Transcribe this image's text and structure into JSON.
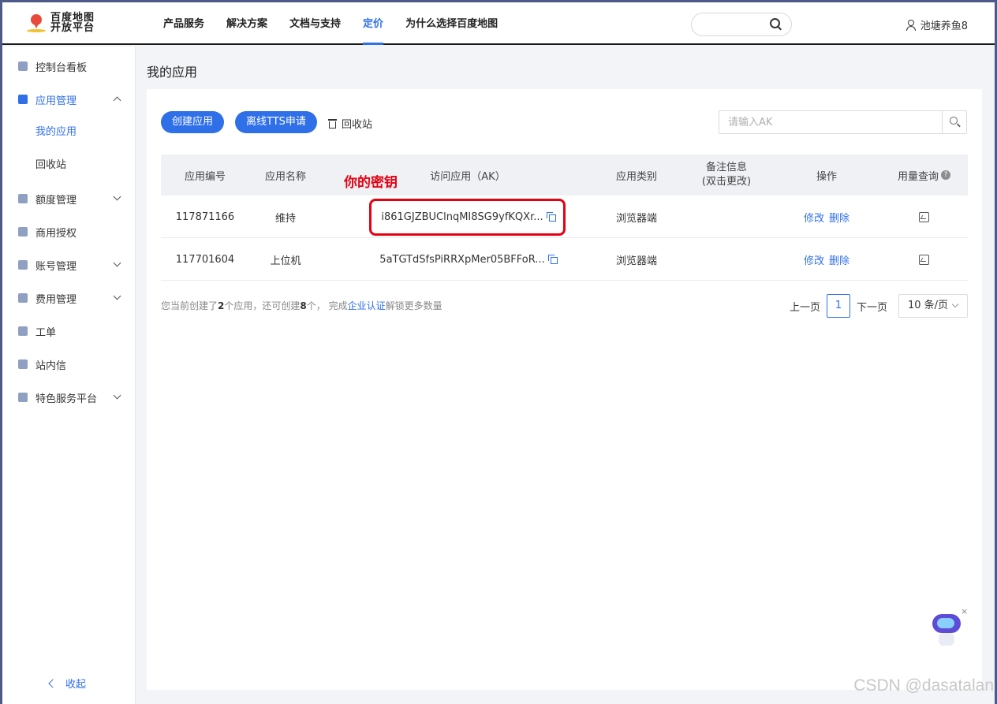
{
  "header": {
    "logo_line1": "百度地图",
    "logo_line2": "开放平台",
    "nav": [
      "产品服务",
      "解决方案",
      "文档与支持",
      "定价",
      "为什么选择百度地图"
    ],
    "active_nav": "定价",
    "user_name": "池塘养鱼8"
  },
  "sidebar": {
    "items": [
      {
        "label": "控制台看板"
      },
      {
        "label": "应用管理"
      },
      {
        "label": "额度管理"
      },
      {
        "label": "商用授权"
      },
      {
        "label": "账号管理"
      },
      {
        "label": "费用管理"
      },
      {
        "label": "工单"
      },
      {
        "label": "站内信"
      },
      {
        "label": "特色服务平台"
      }
    ],
    "sub_items": [
      "我的应用",
      "回收站"
    ],
    "collapse_label": "收起"
  },
  "main": {
    "page_title": "我的应用",
    "create_button": "创建应用",
    "tts_button": "离线TTS申请",
    "recycle_label": "回收站",
    "search_placeholder": "请输入AK",
    "columns": {
      "id": "应用编号",
      "name": "应用名称",
      "ak": "访问应用（AK）",
      "type": "应用类别",
      "note_line1": "备注信息",
      "note_line2": "(双击更改)",
      "actions": "操作",
      "usage": "用量查询"
    },
    "rows": [
      {
        "id": "117871166",
        "name": "维持",
        "ak": "i861GJZBUClnqMI8SG9yfKQXr...",
        "type": "浏览器端",
        "edit": "修改",
        "delete": "删除"
      },
      {
        "id": "117701604",
        "name": "上位机",
        "ak": "5aTGTdSfsPiRRXpMer05BFFoR...",
        "type": "浏览器端",
        "edit": "修改",
        "delete": "删除"
      }
    ],
    "footer": {
      "p1": "您当前创建了",
      "created": "2",
      "p2": "个应用，还可创建",
      "remaining": "8",
      "p3": "个，  完成",
      "link": "企业认证",
      "p4": "解锁更多数量"
    },
    "pager": {
      "prev": "上一页",
      "page": "1",
      "next": "下一页",
      "size": "10 条/页"
    }
  },
  "annotation": {
    "label": "你的密钥",
    "color": "#e60012"
  },
  "watermark": "CSDN @dasatalan",
  "colors": {
    "accent": "#2f6fe8"
  }
}
